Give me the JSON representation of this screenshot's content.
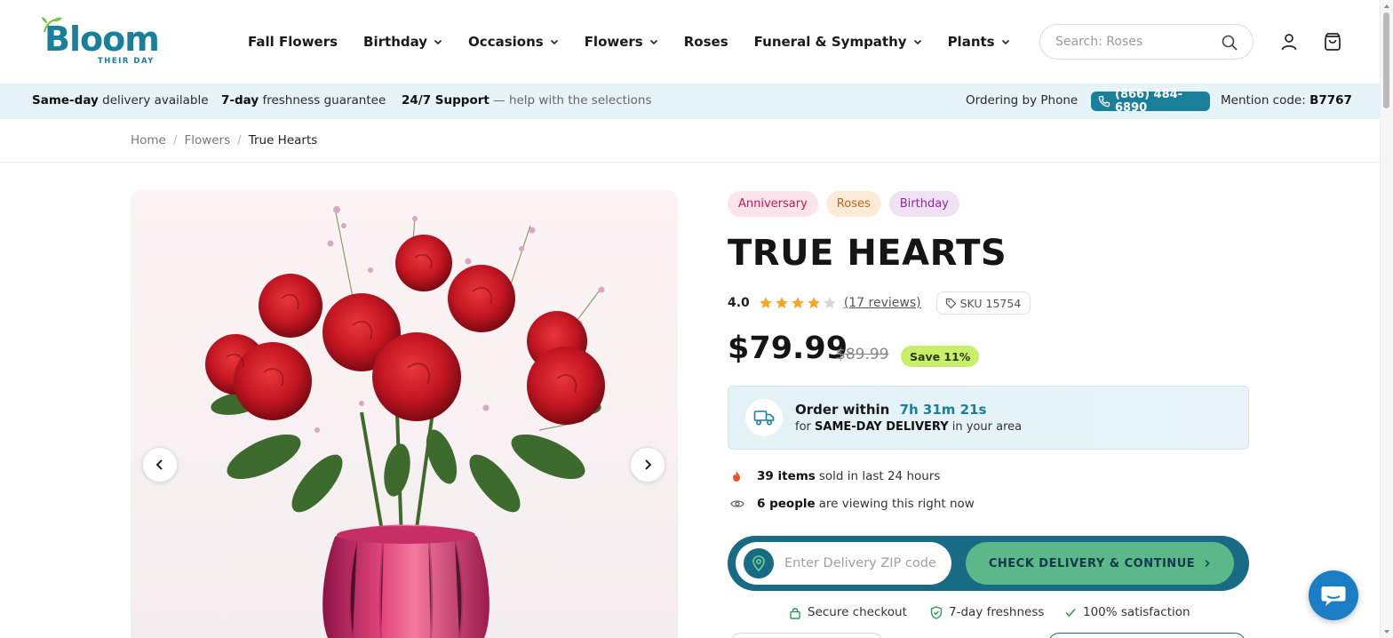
{
  "brand": {
    "name": "Bloom",
    "tagline": "THEIR DAY",
    "color": "#1a7f9a"
  },
  "nav": {
    "items": [
      {
        "label": "Fall Flowers",
        "has_dropdown": false
      },
      {
        "label": "Birthday",
        "has_dropdown": true
      },
      {
        "label": "Occasions",
        "has_dropdown": true
      },
      {
        "label": "Flowers",
        "has_dropdown": true
      },
      {
        "label": "Roses",
        "has_dropdown": false
      },
      {
        "label": "Funeral & Sympathy",
        "has_dropdown": true
      },
      {
        "label": "Plants",
        "has_dropdown": true
      }
    ]
  },
  "search": {
    "placeholder": "Search: Roses",
    "icon": "search-icon"
  },
  "header_icons": [
    "user-icon",
    "shopping-bag-icon"
  ],
  "promo_strip": {
    "delivery_bold": "Same-day",
    "delivery_rest": "delivery available",
    "fresh_bold": "7-day",
    "fresh_rest": "freshness guarantee",
    "support_bold": "24/7 Support",
    "support_rest": "— help with the selections",
    "phone_label": "Ordering by Phone",
    "phone_number": "(866) 484-6890",
    "mention_label": "Mention code:",
    "mention_code": "B7767",
    "background": "#e6f3f8"
  },
  "breadcrumb": {
    "items": [
      "Home",
      "Flowers",
      "True Hearts"
    ],
    "separator": "/"
  },
  "gallery": {
    "image_alt": "Red roses with pink waxflower in a pink vase",
    "prev_icon": "chevron-left-icon",
    "next_icon": "chevron-right-icon"
  },
  "product": {
    "tags": [
      {
        "label": "Anniversary",
        "bg": "#fde3ea",
        "fg": "#c2185b"
      },
      {
        "label": "Roses",
        "bg": "#fdebd8",
        "fg": "#c0651a"
      },
      {
        "label": "Birthday",
        "bg": "#f0e1f5",
        "fg": "#8e2a9c"
      }
    ],
    "title": "TRUE HEARTS",
    "rating": "4.0",
    "rating_value": 4,
    "rating_max": 5,
    "reviews": "(17 reviews)",
    "sku": "SKU 15754",
    "price": "$79.99",
    "old_price": "$89.99",
    "save": "Save 11%"
  },
  "delivery": {
    "order_within": "Order within",
    "timer": "7h 31m 21s",
    "for": "for",
    "same_day": "SAME-DAY DELIVERY",
    "area": "in your area"
  },
  "stats": {
    "sold_bold": "39 items",
    "sold_rest": "sold in last 24 hours",
    "viewers_bold": "6 people",
    "viewers_rest": "are viewing this right now"
  },
  "zip": {
    "placeholder": "Enter Delivery ZIP code",
    "button": "CHECK DELIVERY & CONTINUE"
  },
  "trust": {
    "secure": "Secure checkout",
    "fresh": "7-day freshness",
    "satisfaction": "100% satisfaction"
  },
  "colors": {
    "accent": "#1a7f9a",
    "zip_bar": "#186b84",
    "cta": "#5cb888",
    "star": "#f5a623",
    "save_badge": "#c8ef6a",
    "chat": "#1b7dc4"
  }
}
